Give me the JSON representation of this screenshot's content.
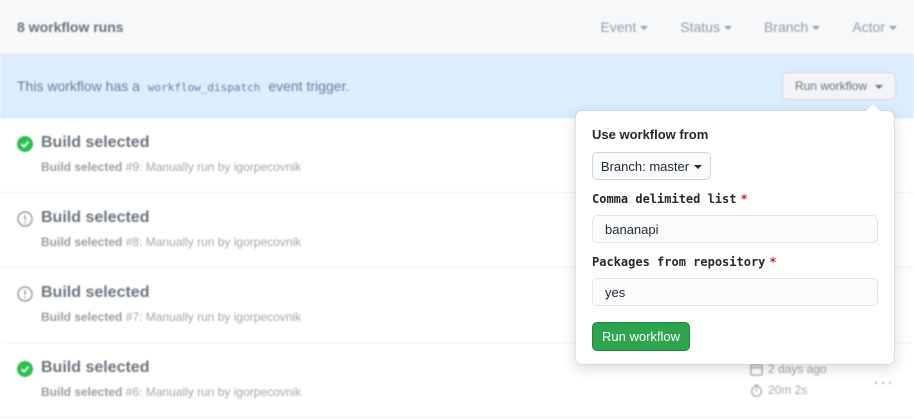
{
  "header": {
    "title": "8 workflow runs",
    "filters": [
      "Event",
      "Status",
      "Branch",
      "Actor"
    ]
  },
  "banner": {
    "prefix": "This workflow has a",
    "code": "workflow_dispatch",
    "suffix": "event trigger.",
    "button_label": "Run workflow"
  },
  "runs": [
    {
      "name": "Build selected",
      "status": "success",
      "workflow": "Build selected",
      "detail": "#9: Manually run by igorpecovnik"
    },
    {
      "name": "Build selected",
      "status": "neutral",
      "workflow": "Build selected",
      "detail": "#8: Manually run by igorpecovnik"
    },
    {
      "name": "Build selected",
      "status": "neutral",
      "workflow": "Build selected",
      "detail": "#7: Manually run by igorpecovnik"
    },
    {
      "name": "Build selected",
      "status": "success",
      "workflow": "Build selected",
      "detail": "#6: Manually run by igorpecovnik",
      "time": "2 days ago",
      "duration": "20m 2s"
    }
  ],
  "dropdown": {
    "use_from_label": "Use workflow from",
    "branch_label": "Branch: master",
    "field1_label": "Comma delimited list",
    "field1_value": "bananapi",
    "field2_label": "Packages from repository",
    "field2_value": "yes",
    "required_mark": "*",
    "submit_label": "Run workflow"
  },
  "colors": {
    "success": "#2cbe4e",
    "neutral": "#959da5",
    "primary_button": "#2ea44f",
    "banner_bg": "#dbedff",
    "required": "#cb2431"
  }
}
